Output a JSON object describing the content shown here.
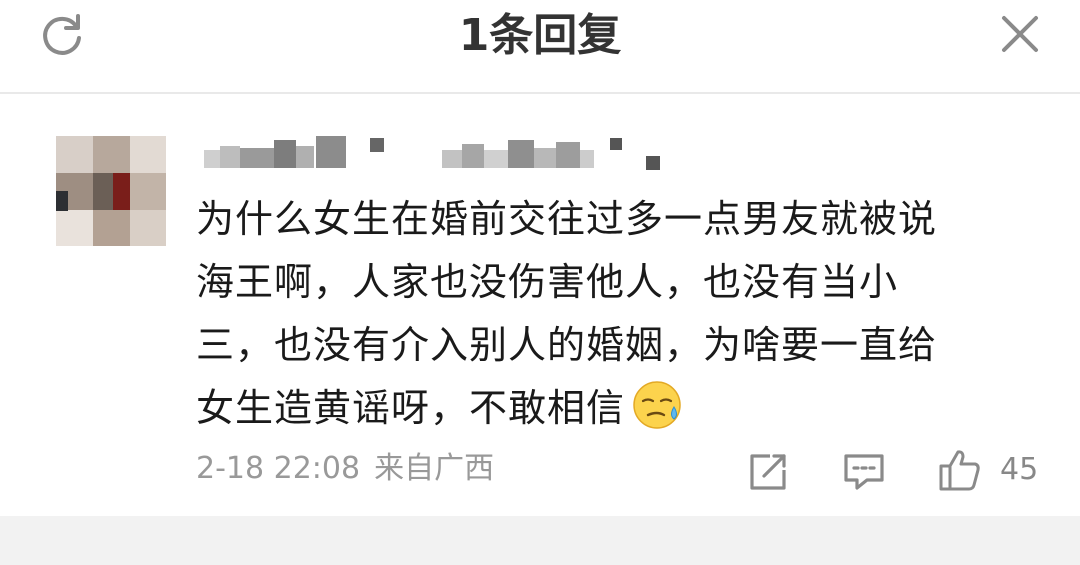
{
  "header": {
    "title": "1条回复",
    "refresh_icon": "refresh-icon",
    "close_icon": "close-icon"
  },
  "comment": {
    "username_blurred": true,
    "text_lines": [
      "为什么女生在婚前交往过多一点男友就被说",
      "海王啊，人家也没伤害他人，也没有当小",
      "三，也没有介入别人的婚姻，为啥要一直给",
      "女生造黄谣呀，不敢相信"
    ],
    "emoji": "sweat-face-emoji",
    "date": "2-18 22:08",
    "location": "来自广西",
    "like_count": "45",
    "actions": {
      "share_icon": "share-icon",
      "reply_icon": "comment-icon",
      "like_icon": "thumbs-up-icon"
    }
  },
  "colors": {
    "text": "#1a1a1a",
    "meta": "#999999",
    "title": "#333333",
    "divider": "#e9e9e9",
    "footer": "#f2f2f2"
  }
}
